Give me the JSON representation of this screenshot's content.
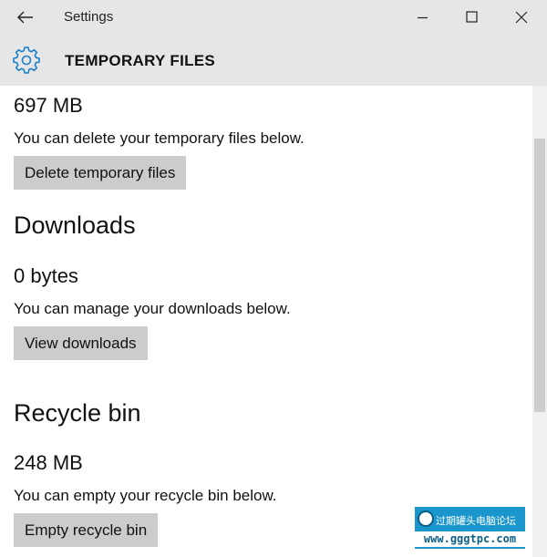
{
  "window": {
    "title": "Settings",
    "controls": {
      "minimize": "minimize",
      "maximize": "maximize",
      "close": "close"
    }
  },
  "header": {
    "title": "TEMPORARY FILES",
    "icon": "gear-icon"
  },
  "sections": {
    "temporary": {
      "size": "697 MB",
      "description": "You can delete your temporary files below.",
      "button": "Delete temporary files"
    },
    "downloads": {
      "heading": "Downloads",
      "size": "0 bytes",
      "description": "You can manage your downloads below.",
      "button": "View downloads"
    },
    "recycle": {
      "heading": "Recycle bin",
      "size": "248 MB",
      "description": "You can empty your recycle bin below.",
      "button": "Empty recycle bin"
    }
  },
  "watermark": {
    "line1": "过期罐头电脑论坛",
    "line2": "www.gggtpc.com"
  },
  "colors": {
    "chrome": "#e6e6e6",
    "button": "#cccccc",
    "accent": "#1a7fc8"
  }
}
